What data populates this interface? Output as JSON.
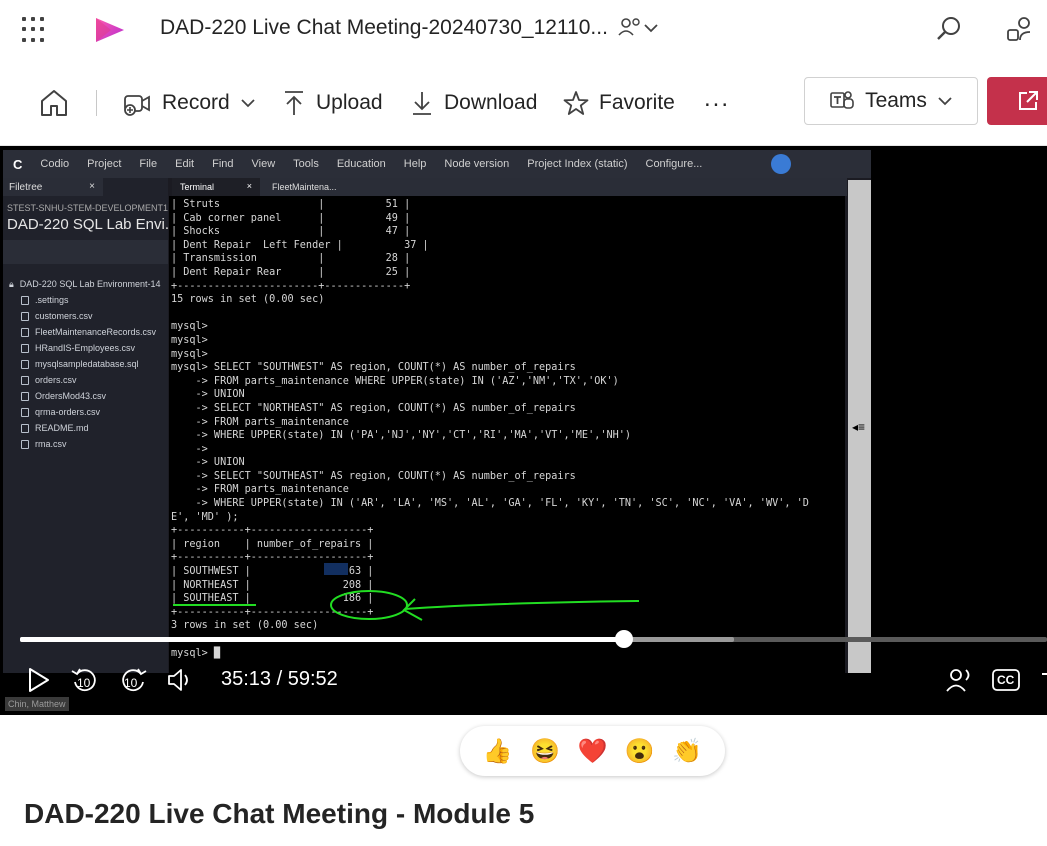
{
  "header": {
    "title": "DAD-220 Live Chat Meeting-20240730_12110..."
  },
  "toolbar": {
    "record_label": "Record",
    "upload_label": "Upload",
    "download_label": "Download",
    "favorite_label": "Favorite",
    "more_label": "...",
    "teams_label": "Teams"
  },
  "ide": {
    "menu": [
      "Codio",
      "Project",
      "File",
      "Edit",
      "Find",
      "View",
      "Tools",
      "Education",
      "Help",
      "Node version",
      "Project Index (static)",
      "Configure..."
    ],
    "filetree_tab": "Filetree",
    "org": "STEST-SNHU-STEM-DEVELOPMENT1",
    "env_title": "DAD-220 SQL Lab Envi...",
    "root_folder": "DAD-220 SQL Lab Environment-14",
    "files": [
      ".settings",
      "customers.csv",
      "FleetMaintenanceRecords.csv",
      "HRandIS-Employees.csv",
      "mysqlsampledatabase.sql",
      "orders.csv",
      "OrdersMod43.csv",
      "qrma-orders.csv",
      "README.md",
      "rma.csv"
    ],
    "tabs": [
      "Terminal",
      "FleetMaintena..."
    ]
  },
  "terminal": {
    "text": "| Struts                |          51 |\n| Cab corner panel      |          49 |\n| Shocks                |          47 |\n| Dent Repair  Left Fender |          37 |\n| Transmission          |          28 |\n| Dent Repair Rear      |          25 |\n+-----------------------+-------------+\n15 rows in set (0.00 sec)\n\nmysql>\nmysql>\nmysql>\nmysql> SELECT \"SOUTHWEST\" AS region, COUNT(*) AS number_of_repairs\n    -> FROM parts_maintenance WHERE UPPER(state) IN ('AZ','NM','TX','OK')\n    -> UNION\n    -> SELECT \"NORTHEAST\" AS region, COUNT(*) AS number_of_repairs\n    -> FROM parts_maintenance\n    -> WHERE UPPER(state) IN ('PA','NJ','NY','CT','RI','MA','VT','ME','NH')\n    ->\n    -> UNION\n    -> SELECT \"SOUTHEAST\" AS region, COUNT(*) AS number_of_repairs\n    -> FROM parts_maintenance\n    -> WHERE UPPER(state) IN ('AR', 'LA', 'MS', 'AL', 'GA', 'FL', 'KY', 'TN', 'SC', 'NC', 'VA', 'WV', 'D\nE', 'MD' );\n+-----------+-------------------+\n| region    | number_of_repairs |\n+-----------+-------------------+\n| SOUTHWEST |                63 |\n| NORTHEAST |               208 |\n| SOUTHEAST |               186 |\n+-----------+-------------------+\n3 rows in set (0.00 sec)\n\nmysql> █"
  },
  "player": {
    "progress_fraction": 0.588,
    "buffer_fraction": 0.695,
    "time_label": "35:13 / 59:52",
    "skip_back_label": "10",
    "skip_forward_label": "10",
    "presenter": "Chin, Matthew",
    "cc_label": "CC"
  },
  "reactions": [
    "👍",
    "😆",
    "❤️",
    "😮",
    "👏"
  ],
  "video_title": "DAD-220 Live Chat Meeting - Module 5",
  "colors": {
    "accent": "#c4314b",
    "green_annotation": "#22dd22"
  }
}
